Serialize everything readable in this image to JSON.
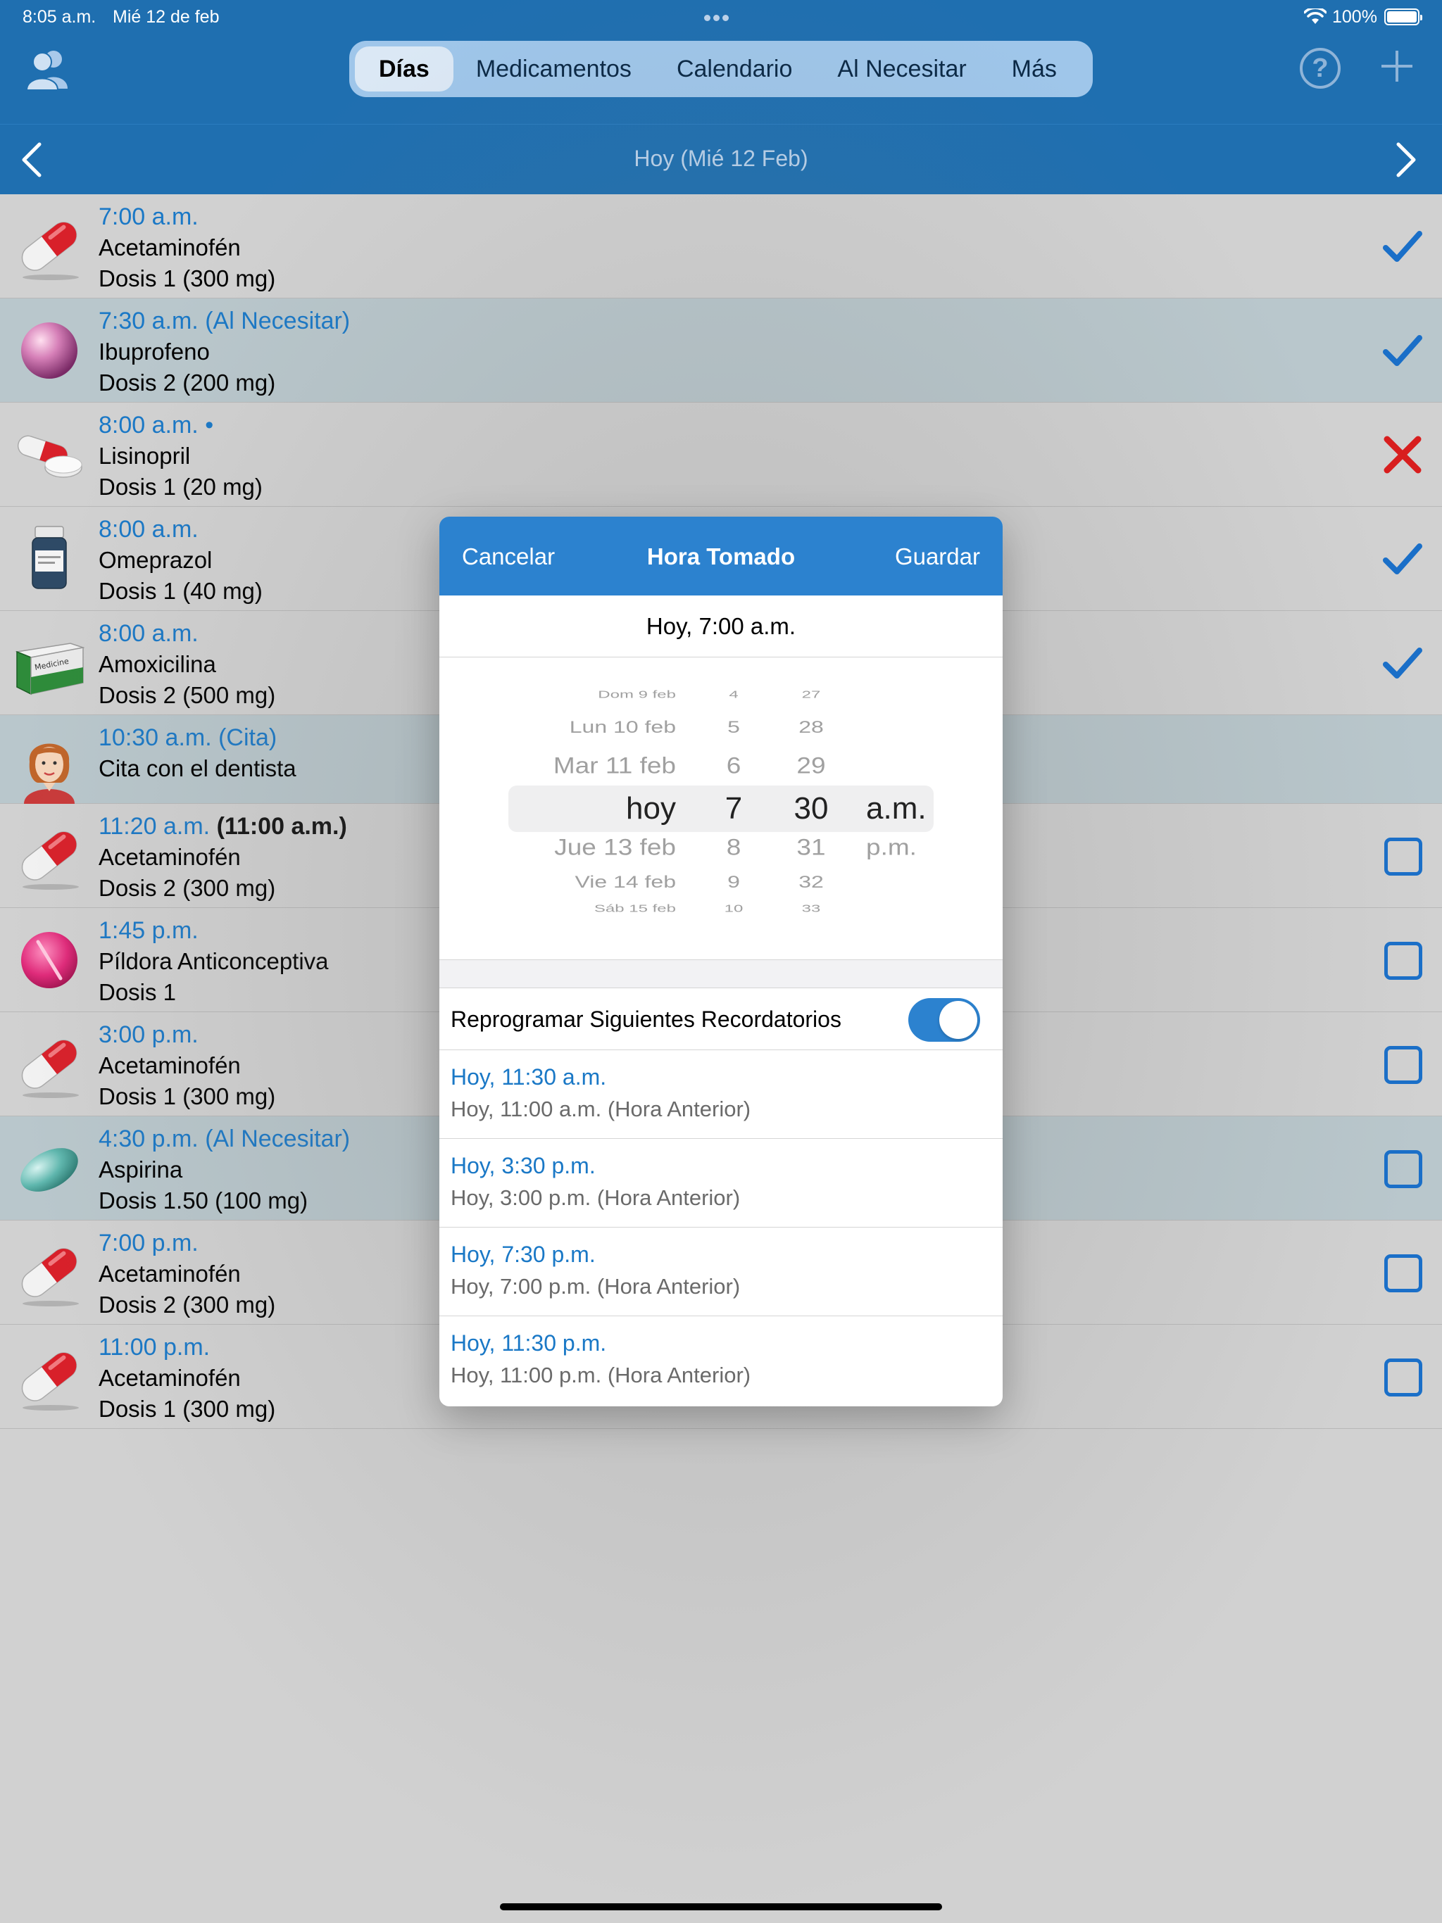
{
  "status": {
    "time": "8:05 a.m.",
    "date": "Mié 12 de feb",
    "battery": "100%"
  },
  "tabs": [
    {
      "label": "Días",
      "active": true
    },
    {
      "label": "Medicamentos",
      "active": false
    },
    {
      "label": "Calendario",
      "active": false
    },
    {
      "label": "Al Necesitar",
      "active": false
    },
    {
      "label": "Más",
      "active": false
    }
  ],
  "help_label": "?",
  "date_title": "Hoy (Mié 12 Feb)",
  "rows": [
    {
      "time": "7:00 a.m.",
      "extra": "",
      "name": "Acetaminofén",
      "dose": "Dosis 1 (300 mg)",
      "status": "taken",
      "icon": "capsule-red-icon",
      "prn": false
    },
    {
      "time": "7:30 a.m. (Al Necesitar)",
      "extra": "",
      "name": "Ibuprofeno",
      "dose": "Dosis 2 (200 mg)",
      "status": "taken",
      "icon": "pink-pearl-icon",
      "prn": true
    },
    {
      "time": "8:00 a.m. •",
      "extra": "",
      "name": "Lisinopril",
      "dose": "Dosis 1 (20 mg)",
      "status": "skipped",
      "icon": "capsule-and-tablet-icon",
      "prn": false
    },
    {
      "time": "8:00 a.m.",
      "extra": "",
      "name": "Omeprazol",
      "dose": "Dosis 1 (40 mg)",
      "status": "taken",
      "icon": "pill-bottle-icon",
      "prn": false
    },
    {
      "time": "8:00 a.m.",
      "extra": "",
      "name": "Amoxicilina",
      "dose": "Dosis 2 (500 mg)",
      "status": "taken",
      "icon": "medicine-box-icon",
      "prn": false
    },
    {
      "time": "10:30 a.m. (Cita)",
      "extra": "",
      "name": "Cita con el dentista",
      "dose": "",
      "status": "none",
      "icon": "person-avatar-icon",
      "prn": true,
      "short": true
    },
    {
      "time": "11:20 a.m.",
      "extra": " (11:00 a.m.)",
      "name": "Acetaminofén",
      "dose": "Dosis 2 (300 mg)",
      "status": "pending",
      "icon": "capsule-red-icon",
      "prn": false
    },
    {
      "time": "1:45 p.m.",
      "extra": "",
      "name": "Píldora Anticonceptiva",
      "dose": "Dosis 1",
      "status": "pending",
      "icon": "pink-tablet-icon",
      "prn": false
    },
    {
      "time": "3:00 p.m.",
      "extra": "",
      "name": "Acetaminofén",
      "dose": "Dosis 1 (300 mg)",
      "status": "pending",
      "icon": "capsule-red-icon",
      "prn": false
    },
    {
      "time": "4:30 p.m. (Al Necesitar)",
      "extra": "",
      "name": "Aspirina",
      "dose": "Dosis 1.50 (100 mg)",
      "status": "pending",
      "icon": "teal-oval-pill-icon",
      "prn": true
    },
    {
      "time": "7:00 p.m.",
      "extra": "",
      "name": "Acetaminofén",
      "dose": "Dosis 2 (300 mg)",
      "status": "pending",
      "icon": "capsule-red-icon",
      "prn": false
    },
    {
      "time": "11:00 p.m.",
      "extra": "",
      "name": "Acetaminofén",
      "dose": "Dosis 1 (300 mg)",
      "status": "pending",
      "icon": "capsule-red-icon",
      "prn": false
    }
  ],
  "modal": {
    "cancel": "Cancelar",
    "title": "Hora Tomado",
    "save": "Guardar",
    "selected": "Hoy, 7:00 a.m.",
    "picker": {
      "days": [
        "Dom 9 feb",
        "Lun 10 feb",
        "Mar 11 feb",
        "hoy",
        "Jue 13 feb",
        "Vie 14 feb",
        "Sáb 15 feb"
      ],
      "hours": [
        "4",
        "5",
        "6",
        "7",
        "8",
        "9",
        "10"
      ],
      "minutes": [
        "27",
        "28",
        "29",
        "30",
        "31",
        "32",
        "33"
      ],
      "ampm": [
        "",
        "",
        "",
        "a.m.",
        "p.m.",
        "",
        ""
      ]
    },
    "toggle_label": "Reprogramar Siguientes Recordatorios",
    "toggle_on": true,
    "reschedule": [
      {
        "new": "Hoy, 11:30 a.m.",
        "old": "Hoy, 11:00 a.m. (Hora Anterior)"
      },
      {
        "new": "Hoy, 3:30 p.m.",
        "old": "Hoy, 3:00 p.m. (Hora Anterior)"
      },
      {
        "new": "Hoy, 7:30 p.m.",
        "old": "Hoy, 7:00 p.m. (Hora Anterior)"
      },
      {
        "new": "Hoy, 11:30 p.m.",
        "old": "Hoy, 11:00 p.m. (Hora Anterior)"
      }
    ]
  },
  "colors": {
    "header": "#1f6fb0",
    "accent": "#1a78c6",
    "taken": "#1a6fc8",
    "skipped": "#d81e1e",
    "prn_row": "#b9c7cc"
  }
}
